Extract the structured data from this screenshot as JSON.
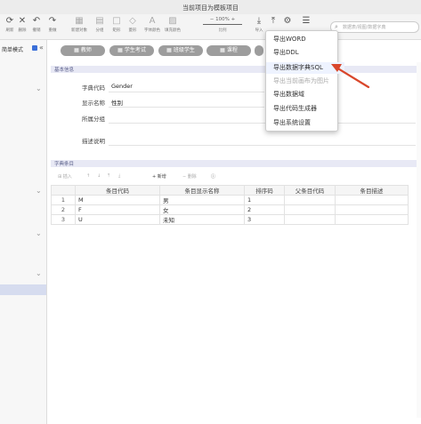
{
  "window": {
    "title": "当前项目为模板项目"
  },
  "toolbar": {
    "items": [
      {
        "icon": "⟳",
        "label": "刷新"
      },
      {
        "icon": "✕",
        "label": "删除"
      },
      {
        "icon": "↶",
        "label": "撤销"
      },
      {
        "icon": "↷",
        "label": "重做"
      },
      {
        "icon": "▦",
        "label": "新建对象"
      },
      {
        "icon": "▤",
        "label": "分组"
      },
      {
        "icon": "□",
        "label": "矩形"
      },
      {
        "icon": "◇",
        "label": "菱形"
      },
      {
        "icon": "A",
        "label": "字体颜色"
      },
      {
        "icon": "▨",
        "label": "填充颜色"
      }
    ],
    "zoom_value": "100%",
    "zoom_minus": "−",
    "zoom_plus": "+",
    "zoom_label": "比例",
    "import_label": "导入",
    "search_placeholder": "数据表/视图/数据字典"
  },
  "sidebar": {
    "mode_label": "简单模式"
  },
  "tabs": [
    {
      "label": "教师"
    },
    {
      "label": "学生考试"
    },
    {
      "label": "班级学生"
    },
    {
      "label": "课程"
    }
  ],
  "basic_info": {
    "header": "基本信息",
    "fields": [
      {
        "label": "字典代码",
        "value": "Gender"
      },
      {
        "label": "显示名称",
        "value": "性别"
      },
      {
        "label": "所属分组",
        "value": ""
      },
      {
        "label": "描述说明",
        "value": ""
      }
    ]
  },
  "dict_items": {
    "header": "字典条目",
    "tools": [
      "插入",
      "新增",
      "删除"
    ],
    "columns": [
      "条目代码",
      "条目显示名称",
      "排序码",
      "父条目代码",
      "条目描述"
    ],
    "rows": [
      {
        "n": "1",
        "code": "M",
        "name": "男",
        "sort": "1",
        "parent": "",
        "desc": ""
      },
      {
        "n": "2",
        "code": "F",
        "name": "女",
        "sort": "2",
        "parent": "",
        "desc": ""
      },
      {
        "n": "3",
        "code": "U",
        "name": "未知",
        "sort": "3",
        "parent": "",
        "desc": ""
      }
    ]
  },
  "export_menu": {
    "items": [
      {
        "label": "导出WORD",
        "disabled": false
      },
      {
        "label": "导出DDL",
        "disabled": false
      },
      {
        "label": "导出数据字典SQL",
        "disabled": false
      },
      {
        "label": "导出当前画布为图片",
        "disabled": true
      },
      {
        "label": "导出数据域",
        "disabled": false
      },
      {
        "label": "导出代码生成器",
        "disabled": false
      },
      {
        "label": "导出系统设置",
        "disabled": false
      }
    ]
  },
  "colors": {
    "accent": "#3a6fd8",
    "arrow": "#d9472b",
    "pill": "#9d9d9d",
    "section": "#e8e9f5"
  }
}
